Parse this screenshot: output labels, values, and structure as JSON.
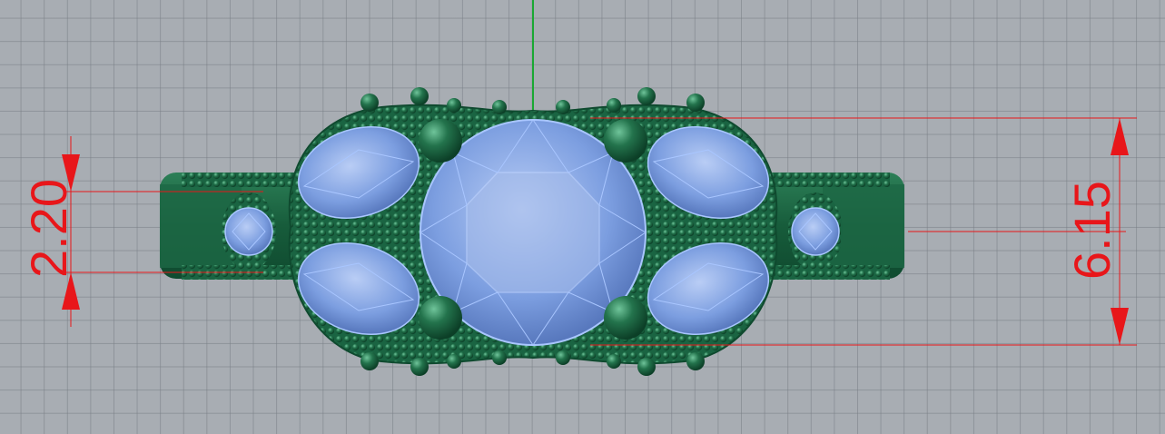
{
  "viewport": {
    "background": "#a8adb3",
    "grid_color": "#7f858c",
    "axis_color": "#1aa832"
  },
  "model": {
    "metal_color": "#1f6e4a",
    "gem_color": "#7ea3e6",
    "gem_edge_color": "#a9c6ff"
  },
  "dimensions": {
    "color": "#e8161a",
    "left_value": "2.20",
    "right_value": "6.15"
  }
}
